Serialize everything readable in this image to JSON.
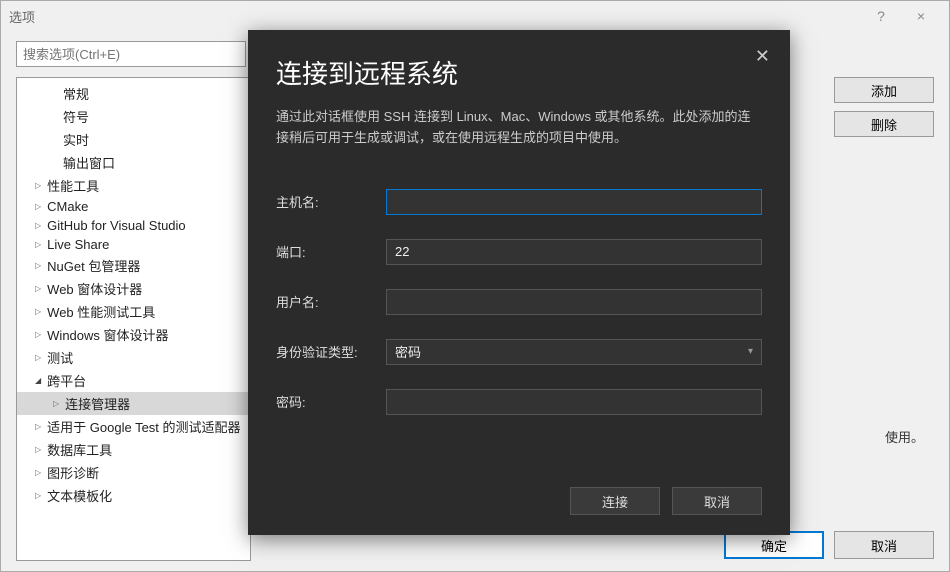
{
  "window": {
    "title": "选项",
    "help": "?",
    "close": "×"
  },
  "search": {
    "placeholder": "搜索选项(Ctrl+E)"
  },
  "tree": {
    "items": [
      {
        "label": "常规",
        "type": "child"
      },
      {
        "label": "符号",
        "type": "child"
      },
      {
        "label": "实时",
        "type": "child"
      },
      {
        "label": "输出窗口",
        "type": "child"
      },
      {
        "label": "性能工具",
        "type": "collapsed"
      },
      {
        "label": "CMake",
        "type": "collapsed"
      },
      {
        "label": "GitHub for Visual Studio",
        "type": "collapsed"
      },
      {
        "label": "Live Share",
        "type": "collapsed"
      },
      {
        "label": "NuGet 包管理器",
        "type": "collapsed"
      },
      {
        "label": "Web 窗体设计器",
        "type": "collapsed"
      },
      {
        "label": "Web 性能测试工具",
        "type": "collapsed"
      },
      {
        "label": "Windows 窗体设计器",
        "type": "collapsed"
      },
      {
        "label": "测试",
        "type": "collapsed"
      },
      {
        "label": "跨平台",
        "type": "expanded"
      },
      {
        "label": "连接管理器",
        "type": "sub-selected"
      },
      {
        "label": "适用于 Google Test 的测试适配器",
        "type": "collapsed"
      },
      {
        "label": "数据库工具",
        "type": "collapsed"
      },
      {
        "label": "图形诊断",
        "type": "collapsed"
      },
      {
        "label": "文本模板化",
        "type": "collapsed"
      }
    ]
  },
  "rightButtons": {
    "add": "添加",
    "remove": "删除"
  },
  "rightText": "使用。",
  "footer": {
    "ok": "确定",
    "cancel": "取消"
  },
  "modal": {
    "title": "连接到远程系统",
    "desc": "通过此对话框使用 SSH 连接到 Linux、Mac、Windows 或其他系统。此处添加的连接稍后可用于生成或调试，或在使用远程生成的项目中使用。",
    "hostLabel": "主机名:",
    "hostValue": "",
    "portLabel": "端口:",
    "portValue": "22",
    "userLabel": "用户名:",
    "userValue": "",
    "authLabel": "身份验证类型:",
    "authValue": "密码",
    "passLabel": "密码:",
    "passValue": "",
    "connect": "连接",
    "cancel": "取消"
  }
}
